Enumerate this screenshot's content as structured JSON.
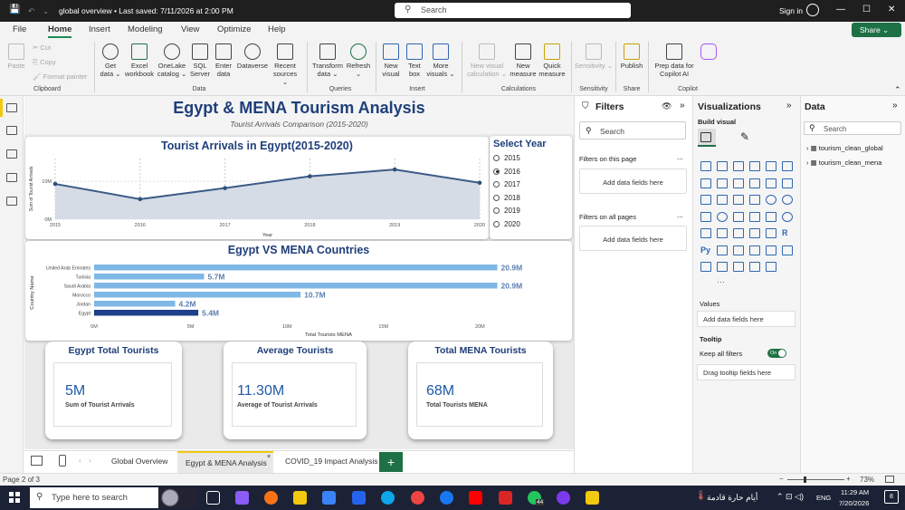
{
  "titlebar": {
    "file_status": "global overview • Last saved: 7/11/2026 at 2:00 PM",
    "search_placeholder": "Search",
    "signin": "Sign in"
  },
  "menu": {
    "items": [
      "File",
      "Home",
      "Insert",
      "Modeling",
      "View",
      "Optimize",
      "Help"
    ],
    "share": "Share"
  },
  "ribbon": {
    "clipboard": {
      "paste": "Paste",
      "cut": "Cut",
      "copy": "Copy",
      "format_painter": "Format painter",
      "group": "Clipboard"
    },
    "data": {
      "get_data": "Get data ⌄",
      "excel": "Excel workbook",
      "onelake": "OneLake catalog ⌄",
      "sql": "SQL Server",
      "enter": "Enter data",
      "dataverse": "Dataverse",
      "recent": "Recent sources ⌄",
      "group": "Data"
    },
    "queries": {
      "transform": "Transform data ⌄",
      "refresh": "Refresh ⌄",
      "group": "Queries"
    },
    "insert": {
      "new_visual": "New visual",
      "text_box": "Text box",
      "more_visuals": "More visuals ⌄",
      "group": "Insert"
    },
    "calculations": {
      "new_visual_calc": "New visual calculation ⌄",
      "new_measure": "New measure",
      "quick_measure": "Quick measure",
      "group": "Calculations"
    },
    "sensitivity": {
      "label": "Sensitivity ⌄",
      "group": "Sensitivity"
    },
    "share": {
      "publish": "Publish",
      "group": "Share"
    },
    "copilot": {
      "prep": "Prep data for Copilot AI",
      "copilot": "Copilot",
      "group": "Copilot"
    }
  },
  "report": {
    "title": "Egypt & MENA Tourism Analysis",
    "subtitle": "Tourist Arrivals Comparison (2015-2020)",
    "line_chart_title": "Tourist Arrivals in Egypt(2015-2020)",
    "bar_chart_title": "Egypt VS MENA Countries",
    "slicer": {
      "title": "Select Year",
      "years": [
        "2015",
        "2016",
        "2017",
        "2018",
        "2019",
        "2020"
      ],
      "selected": "2016"
    },
    "kpis": [
      {
        "title": "Egypt Total Tourists",
        "value": "5M",
        "label": "Sum of Tourist Arrivals"
      },
      {
        "title": "Average Tourists",
        "value": "11.30M",
        "label": "Average of Tourist Arrivals"
      },
      {
        "title": "Total MENA Tourists",
        "value": "68M",
        "label": "Total Tourists MENA"
      }
    ]
  },
  "chart_data": [
    {
      "type": "line",
      "title": "Tourist Arrivals in Egypt(2015-2020)",
      "x": [
        "2015",
        "2016",
        "2017",
        "2018",
        "2019",
        "2020"
      ],
      "y": [
        9.3,
        5.3,
        8.2,
        11.3,
        13.1,
        9.6
      ],
      "xlabel": "Year",
      "ylabel": "Sum of Tourist Arrivals",
      "yticks": [
        "0M",
        "10M"
      ],
      "ylim": [
        0,
        16
      ],
      "grid": true
    },
    {
      "type": "bar",
      "orientation": "horizontal",
      "title": "Egypt VS MENA Countries",
      "categories": [
        "United Arab Emirates",
        "Tunisia",
        "Saudi Arabia",
        "Morocco",
        "Jordan",
        "Egypt"
      ],
      "values": [
        20.9,
        5.7,
        20.9,
        10.7,
        4.2,
        5.4
      ],
      "value_labels": [
        "20.9M",
        "5.7M",
        "20.9M",
        "10.7M",
        "4.2M",
        "5.4M"
      ],
      "xlabel": "Total Tourists MENA",
      "ylabel": "Country Name",
      "xticks": [
        "0M",
        "5M",
        "10M",
        "15M",
        "20M"
      ],
      "xlim": [
        0,
        22
      ],
      "highlight_color": "#1f3f8a",
      "bar_color": "#7fb8e6"
    }
  ],
  "tabs": {
    "items": [
      "Global Overview",
      "Egypt & MENA Analysis",
      "COVID_19 Impact Analysis"
    ],
    "active": "Egypt & MENA Analysis",
    "add": "+"
  },
  "status": {
    "page": "Page 2 of 3",
    "zoom": "73%"
  },
  "filters": {
    "title": "Filters",
    "search": "Search",
    "on_page": "Filters on this page",
    "on_all": "Filters on all pages",
    "add_here": "Add data fields here",
    "more": "..."
  },
  "visualizations": {
    "title": "Visualizations",
    "build": "Build visual",
    "values": "Values",
    "add_here": "Add data fields here",
    "tooltip": "Tooltip",
    "keep_all": "Keep all filters",
    "toggle": "On",
    "drag_tooltip": "Drag tooltip fields here",
    "py": "Py",
    "r": "R",
    "more": "···"
  },
  "data_pane": {
    "title": "Data",
    "search": "Search",
    "tables": [
      "tourism_clean_global",
      "tourism_clean_mena"
    ]
  },
  "taskbar": {
    "search": "Type here to search",
    "badge": "44",
    "weather": "أيام حارة قادمة",
    "lang": "ENG",
    "time": "11:29 AM",
    "date": "7/20/2026",
    "notif": "8"
  }
}
